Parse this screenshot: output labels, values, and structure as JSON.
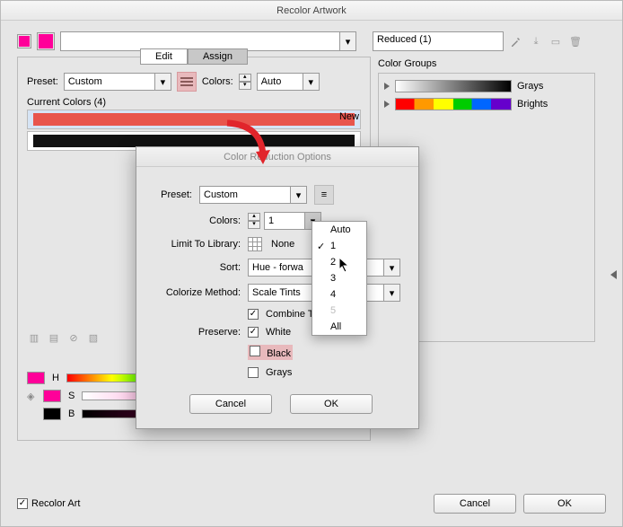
{
  "title": "Recolor Artwork",
  "swatch_color": "#ff0099",
  "reduced_name": "Reduced (1)",
  "tabs": {
    "edit": "Edit",
    "assign": "Assign"
  },
  "main": {
    "preset_label": "Preset:",
    "preset_value": "Custom",
    "colors_label": "Colors:",
    "colors_value": "Auto",
    "current_colors_label": "Current Colors (4)",
    "new_label": "New",
    "bars": [
      {
        "color": "#e8554d",
        "selected": true
      },
      {
        "color": "#111111",
        "selected": false
      }
    ],
    "hsb": {
      "h_label": "H",
      "h_swatch": "#ff0099",
      "s_label": "S",
      "s_swatch": "#ff0099",
      "b_label": "B",
      "b_swatch": "#000000"
    }
  },
  "color_groups": {
    "title": "Color Groups",
    "rows": [
      {
        "label": "Grays",
        "stops": [
          "#ffffff",
          "#000000"
        ]
      },
      {
        "label": "Brights",
        "stops": [
          "#ff0000",
          "#ff9900",
          "#ffff00",
          "#00cc00",
          "#0066ff",
          "#6600cc"
        ]
      }
    ]
  },
  "modal": {
    "title": "Color Reduction Options",
    "preset_label": "Preset:",
    "preset_value": "Custom",
    "colors_label": "Colors:",
    "colors_value": "1",
    "limit_label": "Limit To Library:",
    "limit_value": "None",
    "sort_label": "Sort:",
    "sort_value": "Hue - forwa",
    "colorize_label": "Colorize Method:",
    "colorize_value": "Scale Tints",
    "combine_label": "Combine T",
    "preserve_label": "Preserve:",
    "white_label": "White",
    "black_label": "Black",
    "grays_label": "Grays",
    "cancel": "Cancel",
    "ok": "OK"
  },
  "menu_items": [
    {
      "label": "Auto",
      "checked": false,
      "disabled": false
    },
    {
      "label": "1",
      "checked": true,
      "disabled": false
    },
    {
      "label": "2",
      "checked": false,
      "disabled": false
    },
    {
      "label": "3",
      "checked": false,
      "disabled": false
    },
    {
      "label": "4",
      "checked": false,
      "disabled": false
    },
    {
      "label": "5",
      "checked": false,
      "disabled": true
    },
    {
      "label": "All",
      "checked": false,
      "disabled": false
    }
  ],
  "footer": {
    "recolor_label": "Recolor Art",
    "cancel": "Cancel",
    "ok": "OK"
  }
}
